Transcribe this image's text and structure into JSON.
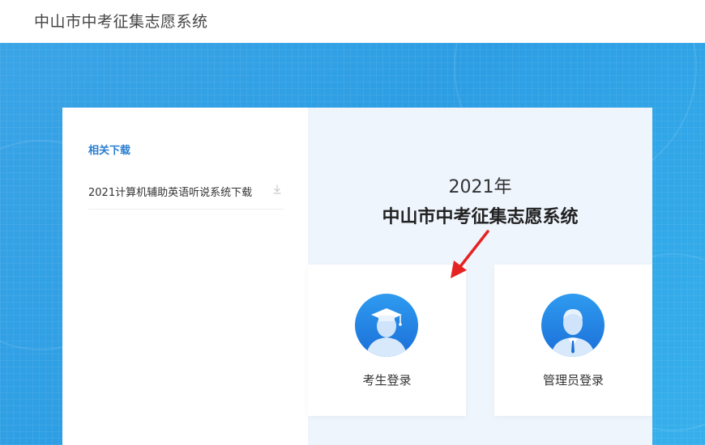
{
  "header": {
    "title": "中山市中考征集志愿系统"
  },
  "downloads": {
    "title": "相关下载",
    "items": [
      {
        "label": "2021计算机辅助英语听说系统下载",
        "icon": "download-icon"
      }
    ]
  },
  "main": {
    "year": "2021年",
    "system_title": "中山市中考征集志愿系统",
    "logins": [
      {
        "label": "考生登录",
        "icon": "graduate-avatar-icon"
      },
      {
        "label": "管理员登录",
        "icon": "admin-avatar-icon"
      }
    ]
  },
  "colors": {
    "banner": "#2d9ee4",
    "accent": "#2b7fd0",
    "panel": "#eef5fd",
    "arrow": "#e52323"
  }
}
